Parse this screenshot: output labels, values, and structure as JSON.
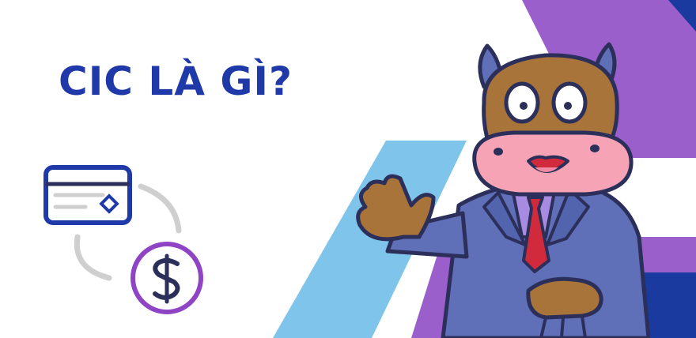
{
  "banner": {
    "headline": "CIC LÀ GÌ?"
  },
  "colors": {
    "headline": "#1f3aa8",
    "purple_stripe": "#9b5fcb",
    "light_blue_stripe": "#7fc4ea",
    "navy_stripe": "#1b3aa0",
    "card_outline": "#1f3aa8",
    "coin_outline": "#8e44c4",
    "arrow_gray": "#cfcfcf",
    "mascot_fur": "#a9743a",
    "mascot_muzzle": "#f5a3b5",
    "suit": "#5f6fb8",
    "tie": "#d02a3c",
    "outline": "#2b2f5a"
  },
  "icons": [
    "credit-card-icon",
    "dollar-coin-icon",
    "cycle-arrows-icon",
    "cow-mascot"
  ]
}
